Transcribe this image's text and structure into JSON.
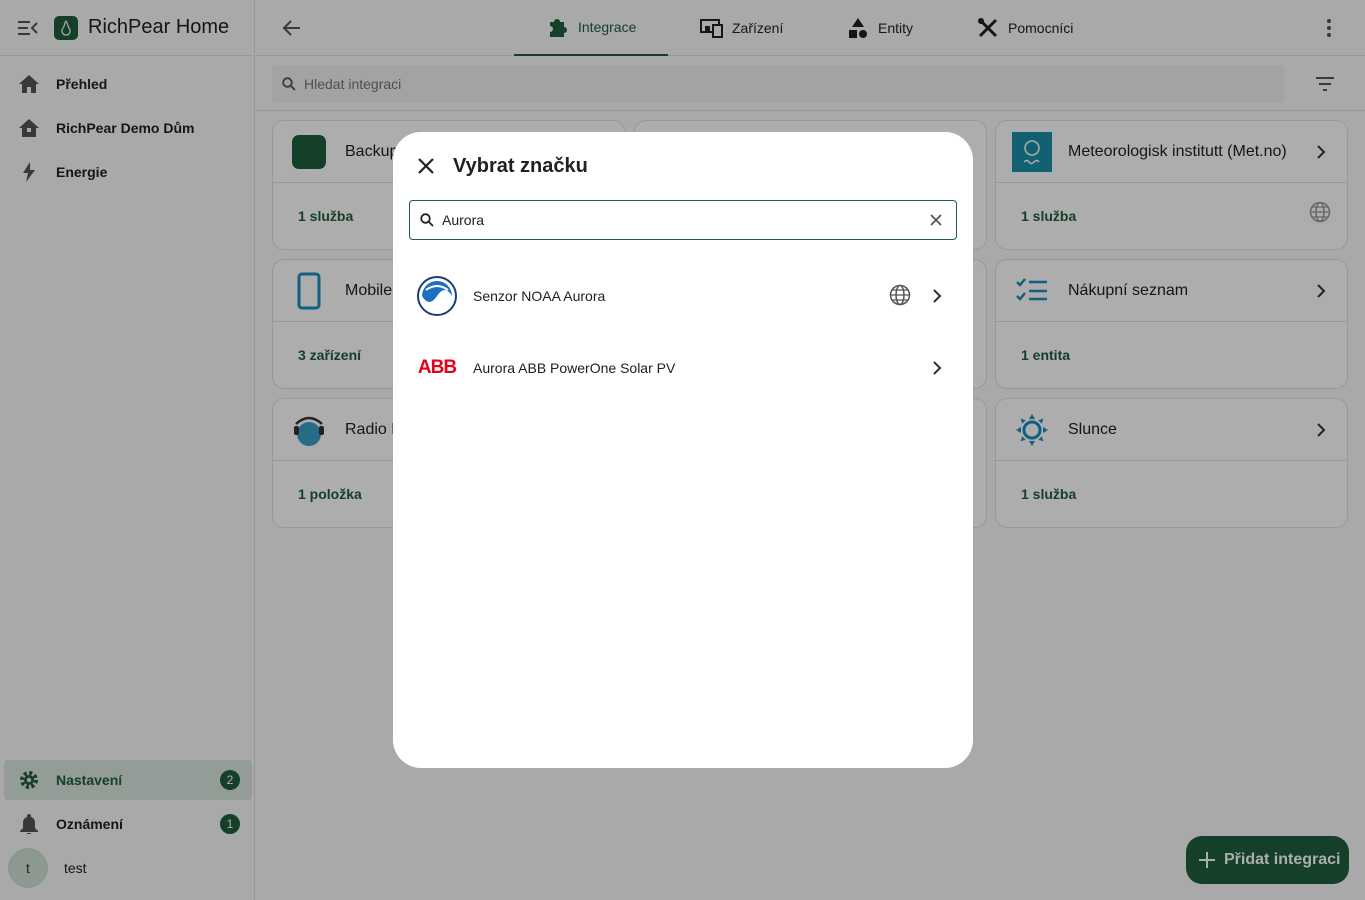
{
  "app": {
    "title": "RichPear Home"
  },
  "sidebar": {
    "items": [
      {
        "label": "Přehled",
        "icon": "home-icon"
      },
      {
        "label": "RichPear Demo Dům",
        "icon": "home-dashboard-icon"
      },
      {
        "label": "Energie",
        "icon": "lightning-icon"
      }
    ],
    "bottom": [
      {
        "label": "Nastavení",
        "icon": "gear-icon",
        "badge": "2"
      },
      {
        "label": "Oznámení",
        "icon": "bell-icon",
        "badge": "1"
      }
    ],
    "user": {
      "initial": "t",
      "name": "test"
    }
  },
  "tabs": [
    {
      "label": "Integrace",
      "icon": "puzzle-icon",
      "active": true
    },
    {
      "label": "Zařízení",
      "icon": "devices-icon"
    },
    {
      "label": "Entity",
      "icon": "shapes-icon"
    },
    {
      "label": "Pomocníci",
      "icon": "tools-icon"
    }
  ],
  "search": {
    "placeholder": "Hledat integraci"
  },
  "cards": [
    {
      "title": "Backup",
      "footer": "1 služba"
    },
    {
      "title": "Meteorologisk institutt (Met.no)",
      "footer": "1 služba"
    },
    {
      "title": "Mobile App",
      "footer": "3 zařízení"
    },
    {
      "title": "Nákupní seznam",
      "footer": "1 entita"
    },
    {
      "title": "Radio Browser",
      "footer": "1 položka"
    },
    {
      "title": "Slunce",
      "footer": "1 služba"
    }
  ],
  "fab": {
    "label": "Přidat integraci"
  },
  "dialog": {
    "title": "Vybrat značku",
    "search_value": "Aurora",
    "results": [
      {
        "name": "Senzor NOAA Aurora",
        "cloud": true
      },
      {
        "name": "Aurora ABB PowerOne Solar PV",
        "logo_text": "ABB"
      }
    ]
  },
  "colors": {
    "primary": "#1e5e3c",
    "accent": "#1c8bc2"
  }
}
